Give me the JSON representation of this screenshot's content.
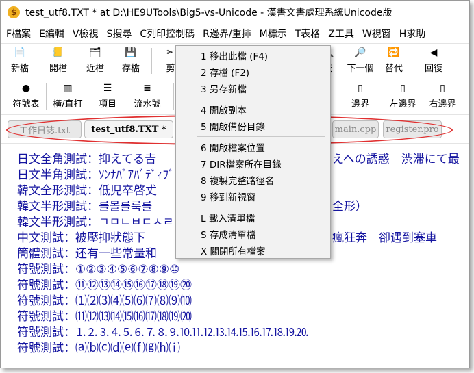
{
  "window": {
    "title": "test_utf8.TXT * at D:\\HE9UTools\\Big5-vs-Unicode - 漢書文書處理系統Unicode版",
    "app_icon_glyph": "$"
  },
  "menubar": [
    "F檔案",
    "E編輯",
    "V檢視",
    "S搜尋",
    "C列印控制碼",
    "R邊界/重排",
    "M標示",
    "T表格",
    "Z工具",
    "W視窗",
    "H求助"
  ],
  "toolbar1": [
    {
      "label": "新檔",
      "icon": "new-file-icon",
      "glyph": "📄"
    },
    {
      "label": "開檔",
      "icon": "open-file-icon",
      "glyph": "📒"
    },
    {
      "label": "近檔",
      "icon": "recent-file-icon",
      "glyph": "🗂"
    },
    {
      "label": "存檔",
      "icon": "save-icon",
      "glyph": "💾"
    },
    {
      "label": "剪",
      "icon": "cut-icon",
      "glyph": "✂"
    },
    {
      "label": "找",
      "icon": "find-icon",
      "glyph": "🔍"
    },
    {
      "label": "下一個",
      "icon": "find-next-icon",
      "glyph": "🔎"
    },
    {
      "label": "替代",
      "icon": "replace-icon",
      "glyph": "🔁"
    },
    {
      "label": "回復",
      "icon": "undo-icon",
      "glyph": "◀"
    }
  ],
  "toolbar2": [
    {
      "label": "符號表",
      "icon": "symbol-table-icon",
      "glyph": "●"
    },
    {
      "label": "橫/直打",
      "icon": "text-direction-icon",
      "glyph": "▥"
    },
    {
      "label": "項目",
      "icon": "bullet-list-icon",
      "glyph": "☰"
    },
    {
      "label": "流水號",
      "icon": "numbered-list-icon",
      "glyph": "≣"
    },
    {
      "label": "邊界",
      "icon": "margin-icon",
      "glyph": "▯"
    },
    {
      "label": "左邊界",
      "icon": "left-margin-icon",
      "glyph": "▯"
    },
    {
      "label": "右邊界",
      "icon": "right-margin-icon",
      "glyph": "▯"
    }
  ],
  "tabs": [
    {
      "label": "工作日誌.txt",
      "active": false
    },
    {
      "label": "test_utf8.TXT *",
      "active": true
    },
    {
      "label": "main.cpp",
      "active": false
    },
    {
      "label": "register.pro",
      "active": false
    }
  ],
  "editor_lines": [
    "日文全角測試：抑えてる𠮷",
    "日文半角測試：ｿﾝﾅﾊﾞｱﾊﾞﾃﾞｨﾌﾞｨｽ",
    "韓文全形測試：低児卒啓𠀋",
    "韓文半形測試：를몰를룩를",
    "韓文半形測試：ㄱㅁㄴㅂㄷㅅㄹㅇㅈㅊ",
    "中文測試：被壓抑狀態下",
    "簡體測試：还有一些常量和",
    "符號測試：①②③④⑤⑥⑦⑧⑨⑩",
    "符號測試：⑪⑫⑬⑭⑮⑯⑰⑱⑲⑳",
    "符號測試：⑴⑵⑶⑷⑸⑹⑺⑻⑼⑽",
    "符號測試：⑾⑿⒀⒁⒂⒃⒄⒅⒆⒇",
    "符號測試：⒈⒉⒊⒋⒌⒍⒎⒏⒐⒑⒒⒓⒔⒕⒖⒗⒘⒙⒚⒛",
    "符號測試：⒜⒝⒞⒟⒠⒡⒢⒣⒤"
  ],
  "editor_right_fragments": [
    {
      "text": "えへの誘惑　渋滞にて最",
      "line": 0
    },
    {
      "text": "全形）",
      "line": 3
    },
    {
      "text": "瘋狂奔　卻遇到塞車",
      "line": 5
    }
  ],
  "context_menu": {
    "items": [
      {
        "label": "1 移出此檔 (F4)",
        "sep_after": false
      },
      {
        "label": "2 存檔 (F2)",
        "sep_after": false
      },
      {
        "label": "3 另存新檔",
        "sep_after": true
      },
      {
        "label": "4 開啟副本",
        "sep_after": false
      },
      {
        "label": "5 開啟備份目錄",
        "sep_after": true
      },
      {
        "label": "6 開啟檔案位置",
        "sep_after": false
      },
      {
        "label": "7 DIR檔案所在目錄",
        "sep_after": false
      },
      {
        "label": "8 複製完整路徑名",
        "sep_after": false
      },
      {
        "label": "9 移到新視窗",
        "sep_after": true
      },
      {
        "label": "L 載入清單檔",
        "sep_after": false
      },
      {
        "label": "S 存成清單檔",
        "sep_after": false
      },
      {
        "label": "X 關閉所有檔案",
        "sep_after": false
      }
    ]
  },
  "colors": {
    "editor_text": "#1515a0",
    "highlight_oval": "#e03030"
  }
}
